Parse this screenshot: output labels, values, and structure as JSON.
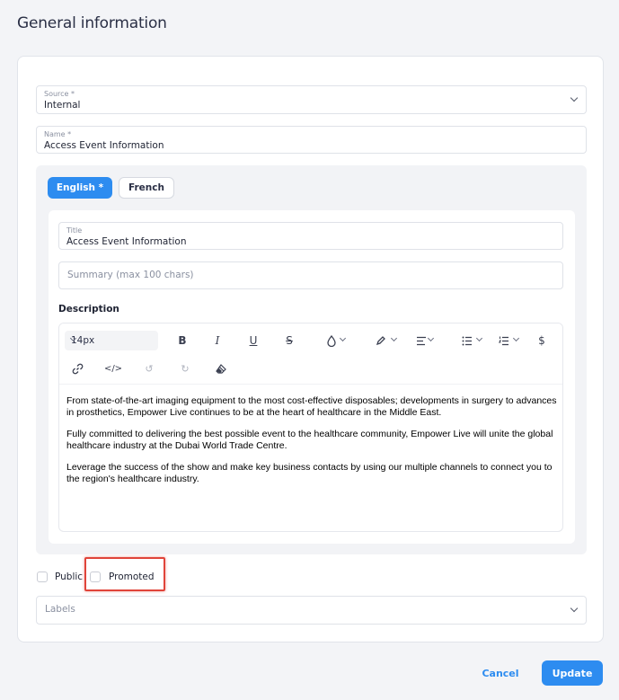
{
  "page": {
    "title": "General information"
  },
  "form": {
    "source": {
      "label": "Source *",
      "value": "Internal"
    },
    "name": {
      "label": "Name *",
      "value": "Access Event Information"
    },
    "tabs": [
      {
        "label": "English *",
        "active": true
      },
      {
        "label": "French",
        "active": false
      }
    ],
    "title": {
      "label": "Title",
      "value": "Access Event Information"
    },
    "summary": {
      "placeholder": "Summary (max 100 chars)"
    },
    "description": {
      "label": "Description",
      "font_size": "14px",
      "paragraphs": [
        "From state-of-the-art imaging equipment to the most cost-effective disposables; developments in surgery to advances in prosthetics, Empower Live continues to be at the heart of healthcare in the Middle East.",
        "Fully committed to delivering the best possible event to the healthcare community, Empower Live will unite the global healthcare industry at the Dubai World Trade Centre.",
        "Leverage the success of the show and make key business contacts by using our multiple channels to connect you to the region's healthcare industry."
      ]
    },
    "public": {
      "label": "Public",
      "checked": false
    },
    "promoted": {
      "label": "Promoted",
      "checked": false
    },
    "labels": {
      "placeholder": "Labels"
    }
  },
  "actions": {
    "cancel": "Cancel",
    "update": "Update"
  },
  "colors": {
    "accent": "#2d8cf0",
    "highlight": "#e0443a"
  }
}
